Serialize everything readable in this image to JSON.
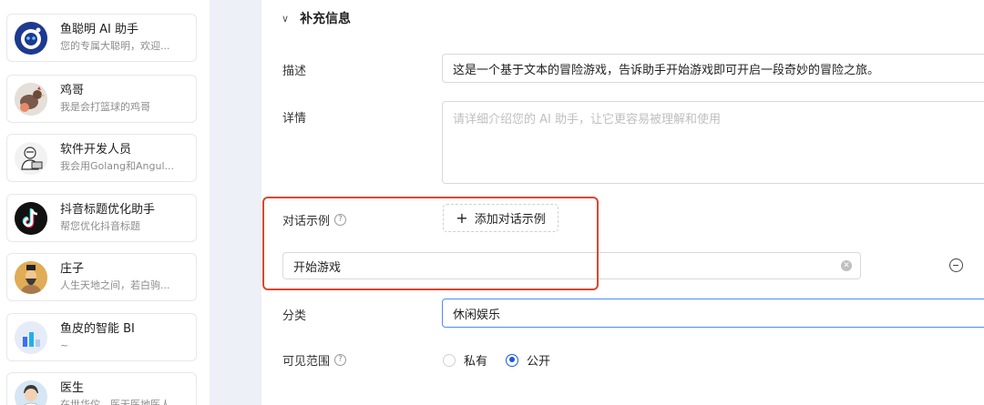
{
  "assistants": [
    {
      "title": "鱼聪明 AI 助手",
      "desc": "您的专属大聪明，欢迎...",
      "icon": "robot-icon"
    },
    {
      "title": "鸡哥",
      "desc": "我是会打篮球的鸡哥",
      "icon": "chicken-avatar"
    },
    {
      "title": "软件开发人员",
      "desc": "我会用Golang和Angul...",
      "icon": "developer-avatar"
    },
    {
      "title": "抖音标题优化助手",
      "desc": "帮您优化抖音标题",
      "icon": "douyin-logo"
    },
    {
      "title": "庄子",
      "desc": "人生天地之间，若白驹...",
      "icon": "zhuangzi-avatar"
    },
    {
      "title": "鱼皮的智能 BI",
      "desc": "~",
      "icon": "bar-chart-icon"
    },
    {
      "title": "医生",
      "desc": "在世华佗，医无医地医人",
      "icon": "doctor-avatar"
    }
  ],
  "form": {
    "section_toggle": "∨",
    "section_title": "补充信息",
    "description_label": "描述",
    "description_value": "这是一个基于文本的冒险游戏，告诉助手开始游戏即可开启一段奇妙的冒险之旅。",
    "details_label": "详情",
    "details_placeholder": "请详细介绍您的 AI 助手，让它更容易被理解和使用",
    "examples_label": "对话示例",
    "add_example_label": "添加对话示例",
    "example_value": "开始游戏",
    "category_label": "分类",
    "category_value": "休闲娱乐",
    "visibility_label": "可见范围",
    "visibility_options": [
      "私有",
      "公开"
    ],
    "visibility_selected": "公开"
  },
  "colors": {
    "accent": "#1a56e8",
    "highlight_border": "#d9472f",
    "sidebar_bg": "#eef0f8"
  }
}
